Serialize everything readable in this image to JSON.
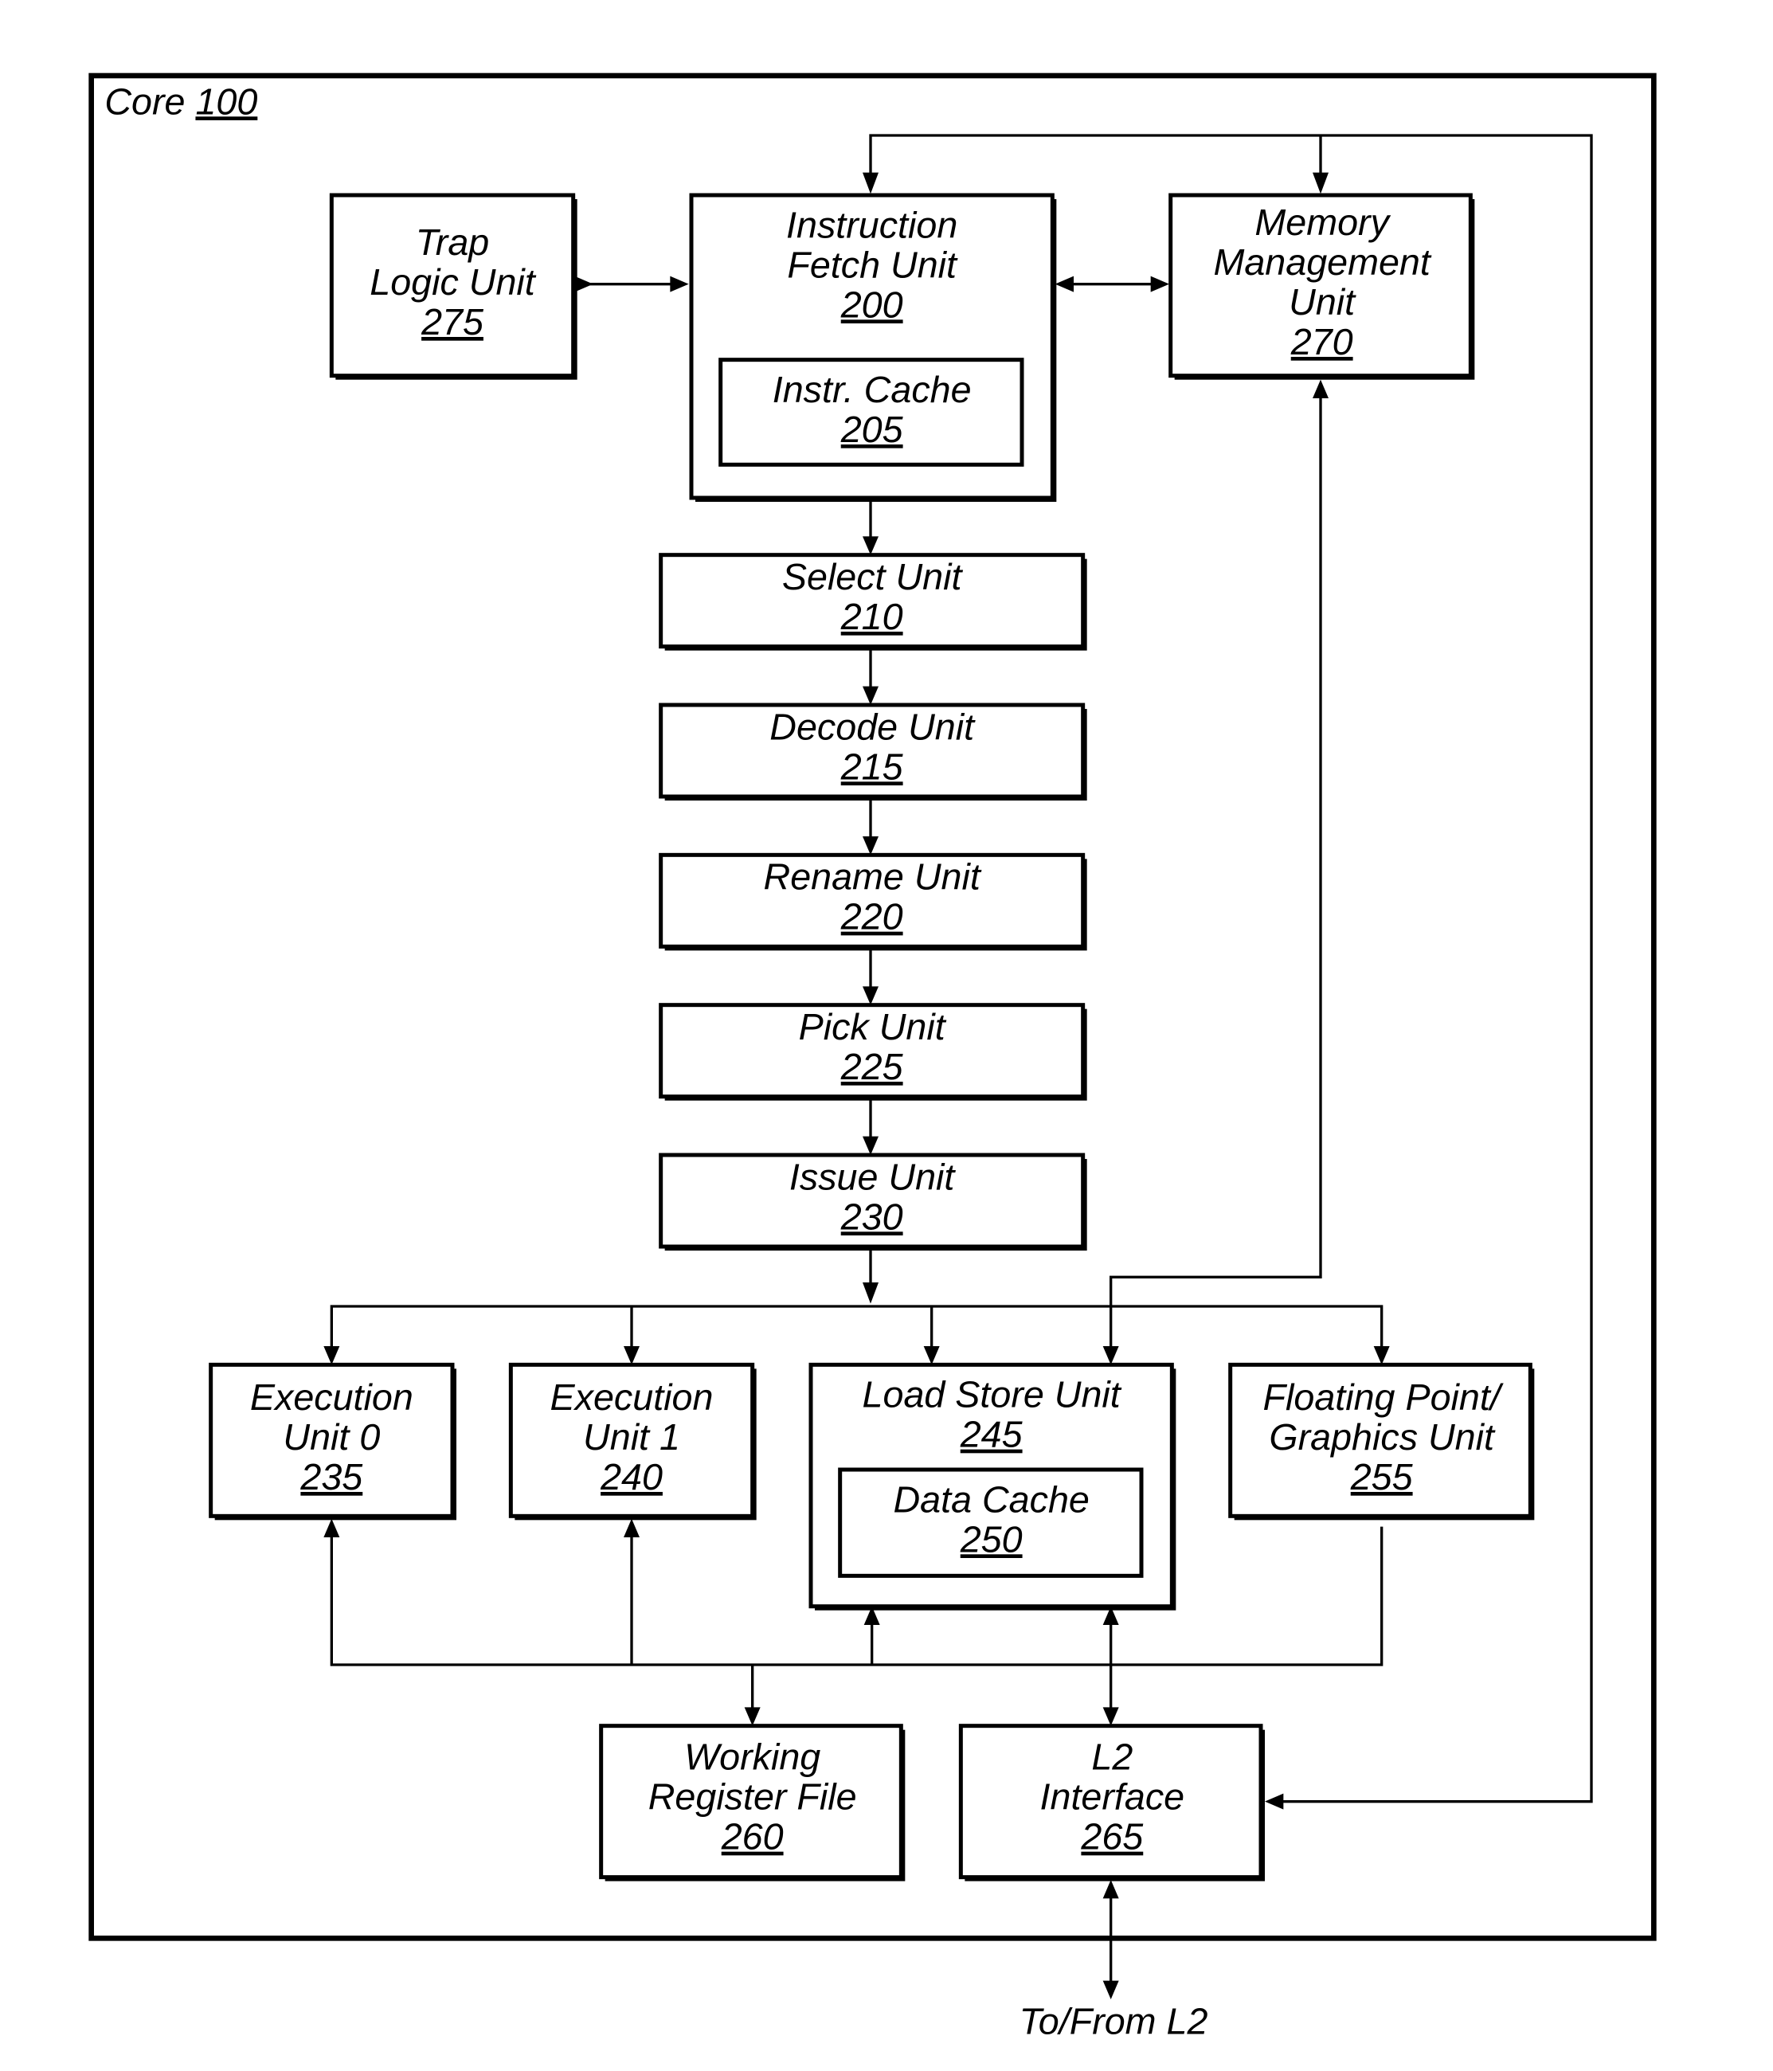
{
  "core": {
    "label": "Core",
    "number": "100"
  },
  "units": {
    "trap": {
      "lines": [
        "Trap",
        "Logic Unit"
      ],
      "number": "275"
    },
    "ifu": {
      "lines": [
        "Instruction",
        "Fetch Unit"
      ],
      "number": "200"
    },
    "icache": {
      "lines": [
        "Instr. Cache"
      ],
      "number": "205"
    },
    "mmu": {
      "lines": [
        "Memory",
        "Management",
        "Unit"
      ],
      "number": "270"
    },
    "select": {
      "lines": [
        "Select Unit"
      ],
      "number": "210"
    },
    "decode": {
      "lines": [
        "Decode Unit"
      ],
      "number": "215"
    },
    "rename": {
      "lines": [
        "Rename Unit"
      ],
      "number": "220"
    },
    "pick": {
      "lines": [
        "Pick Unit"
      ],
      "number": "225"
    },
    "issue": {
      "lines": [
        "Issue Unit"
      ],
      "number": "230"
    },
    "exec0": {
      "lines": [
        "Execution",
        "Unit 0"
      ],
      "number": "235"
    },
    "exec1": {
      "lines": [
        "Execution",
        "Unit 1"
      ],
      "number": "240"
    },
    "lsu": {
      "lines": [
        "Load Store Unit"
      ],
      "number": "245"
    },
    "dcache": {
      "lines": [
        "Data Cache"
      ],
      "number": "250"
    },
    "fgu": {
      "lines": [
        "Floating Point/",
        "Graphics Unit"
      ],
      "number": "255"
    },
    "wrf": {
      "lines": [
        "Working",
        "Register File"
      ],
      "number": "260"
    },
    "l2if": {
      "lines": [
        "L2",
        "Interface"
      ],
      "number": "265"
    }
  },
  "external": {
    "label": "To/From L2"
  }
}
